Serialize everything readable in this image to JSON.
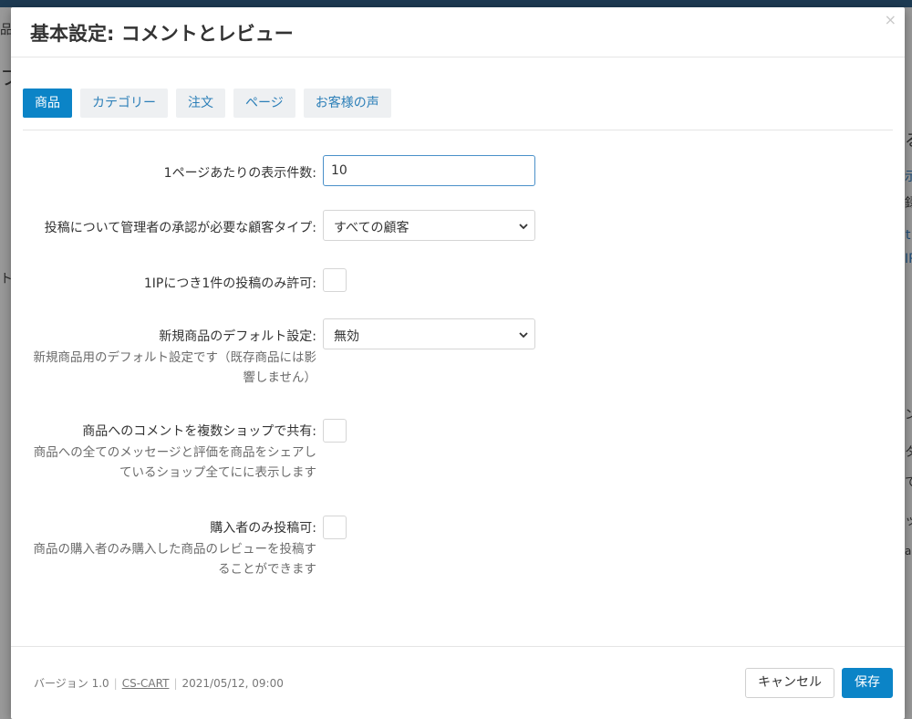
{
  "background_fragments": [
    "品",
    "フ",
    "る",
    "示",
    "録",
    "t",
    "IP",
    "ト",
    "ン",
    "タ",
    "て",
    "ッ",
    "an"
  ],
  "modal": {
    "title": "基本設定: コメントとレビュー",
    "close_symbol": "×"
  },
  "tabs": [
    {
      "label": "商品",
      "active": true
    },
    {
      "label": "カテゴリー",
      "active": false
    },
    {
      "label": "注文",
      "active": false
    },
    {
      "label": "ページ",
      "active": false
    },
    {
      "label": "お客様の声",
      "active": false
    }
  ],
  "fields": {
    "per_page": {
      "label": "1ページあたりの表示件数:",
      "value": "10"
    },
    "approval": {
      "label": "投稿について管理者の承認が必要な顧客タイプ:",
      "selected": "すべての顧客"
    },
    "one_per_ip": {
      "label": "1IPにつき1件の投稿のみ許可:",
      "checked": false
    },
    "new_product_default": {
      "label": "新規商品のデフォルト設定:",
      "description": "新規商品用のデフォルト設定です（既存商品には影響しません）",
      "selected": "無効"
    },
    "share_comments": {
      "label": "商品へのコメントを複数ショップで共有:",
      "description": "商品への全てのメッセージと評価を商品をシェアしているショップ全てにに表示します",
      "checked": false
    },
    "buyers_only": {
      "label": "購入者のみ投稿可:",
      "description": "商品の購入者のみ購入した商品のレビューを投稿することができます",
      "checked": false
    }
  },
  "footer": {
    "version": "バージョン 1.0",
    "vendor_link": "CS-CART",
    "timestamp": "2021/05/12, 09:00",
    "cancel_label": "キャンセル",
    "save_label": "保存"
  },
  "colors": {
    "accent": "#0b84c7",
    "tab_inactive_bg": "#eef0f2",
    "tab_inactive_text": "#2c7fb8",
    "overlay": "#9a9a9a"
  }
}
